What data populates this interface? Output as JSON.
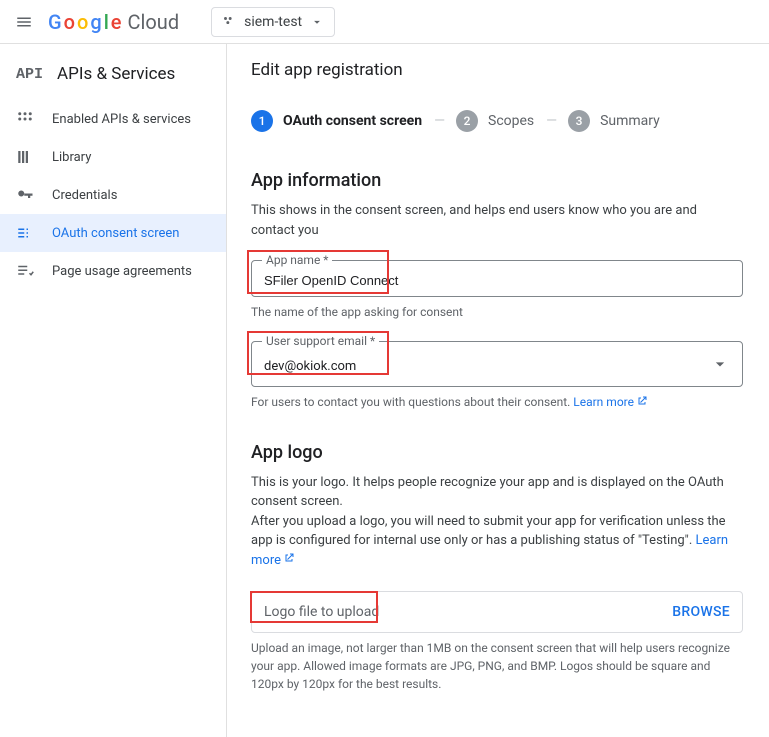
{
  "topbar": {
    "brand_google": "Google",
    "brand_cloud": "Cloud",
    "project_name": "siem-test"
  },
  "sidebar": {
    "title": "APIs & Services",
    "items": [
      {
        "label": "Enabled APIs & services"
      },
      {
        "label": "Library"
      },
      {
        "label": "Credentials"
      },
      {
        "label": "OAuth consent screen"
      },
      {
        "label": "Page usage agreements"
      }
    ]
  },
  "page": {
    "title": "Edit app registration"
  },
  "stepper": {
    "steps": [
      {
        "num": "1",
        "label": "OAuth consent screen"
      },
      {
        "num": "2",
        "label": "Scopes"
      },
      {
        "num": "3",
        "label": "Summary"
      }
    ]
  },
  "app_info": {
    "heading": "App information",
    "desc": "This shows in the consent screen, and helps end users know who you are and contact you",
    "name_label": "App name *",
    "name_value": "SFiler OpenID Connect",
    "name_helper": "The name of the app asking for consent",
    "email_label": "User support email *",
    "email_value": "dev@okiok.com",
    "email_helper": "For users to contact you with questions about their consent. ",
    "learn_more": "Learn more"
  },
  "app_logo": {
    "heading": "App logo",
    "desc1": "This is your logo. It helps people recognize your app and is displayed on the OAuth consent screen.",
    "desc2_a": "After you upload a logo, you will need to submit your app for verification unless the app is configured for internal use only or has a publishing status of \"Testing\". ",
    "learn_more": "Learn more",
    "upload_placeholder": "Logo file to upload",
    "browse": "BROWSE",
    "upload_helper": "Upload an image, not larger than 1MB on the consent screen that will help users recognize your app. Allowed image formats are JPG, PNG, and BMP. Logos should be square and 120px by 120px for the best results."
  }
}
